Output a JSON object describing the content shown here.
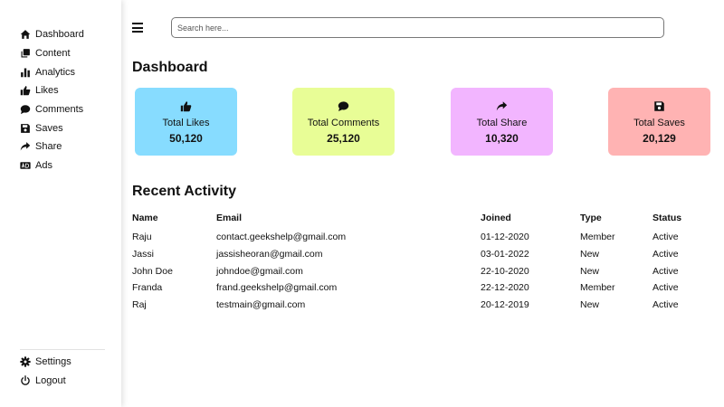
{
  "sidebar": {
    "items": [
      {
        "label": "Dashboard",
        "icon": "home-icon"
      },
      {
        "label": "Content",
        "icon": "copy-icon"
      },
      {
        "label": "Analytics",
        "icon": "bar-chart-icon"
      },
      {
        "label": "Likes",
        "icon": "thumbs-up-icon"
      },
      {
        "label": "Comments",
        "icon": "comment-icon"
      },
      {
        "label": "Saves",
        "icon": "save-icon"
      },
      {
        "label": "Share",
        "icon": "share-icon"
      },
      {
        "label": "Ads",
        "icon": "ad-icon"
      }
    ],
    "bottom": [
      {
        "label": "Settings",
        "icon": "gear-icon"
      },
      {
        "label": "Logout",
        "icon": "power-icon"
      }
    ]
  },
  "header": {
    "search_placeholder": "Search here..."
  },
  "main": {
    "title": "Dashboard",
    "cards": [
      {
        "label": "Total Likes",
        "value": "50,120",
        "color": "#87dcff",
        "icon": "thumbs-up-icon"
      },
      {
        "label": "Total Comments",
        "value": "25,120",
        "color": "#e8fd96",
        "icon": "comment-icon"
      },
      {
        "label": "Total Share",
        "value": "10,320",
        "color": "#f2b5ff",
        "icon": "share-icon"
      },
      {
        "label": "Total Saves",
        "value": "20,129",
        "color": "#ffb3b3",
        "icon": "save-icon"
      }
    ],
    "activity": {
      "title": "Recent Activity",
      "columns": [
        "Name",
        "Email",
        "Joined",
        "Type",
        "Status"
      ],
      "rows": [
        [
          "Raju",
          "contact.geekshelp@gmail.com",
          "01-12-2020",
          "Member",
          "Active"
        ],
        [
          "Jassi",
          "jassisheoran@gmail.com",
          "03-01-2022",
          "New",
          "Active"
        ],
        [
          "John Doe",
          "johndoe@gmail.com",
          "22-10-2020",
          "New",
          "Active"
        ],
        [
          "Franda",
          "frand.geekshelp@gmail.com",
          "22-12-2020",
          "Member",
          "Active"
        ],
        [
          "Raj",
          "testmain@gmail.com",
          "20-12-2019",
          "New",
          "Active"
        ]
      ]
    }
  }
}
